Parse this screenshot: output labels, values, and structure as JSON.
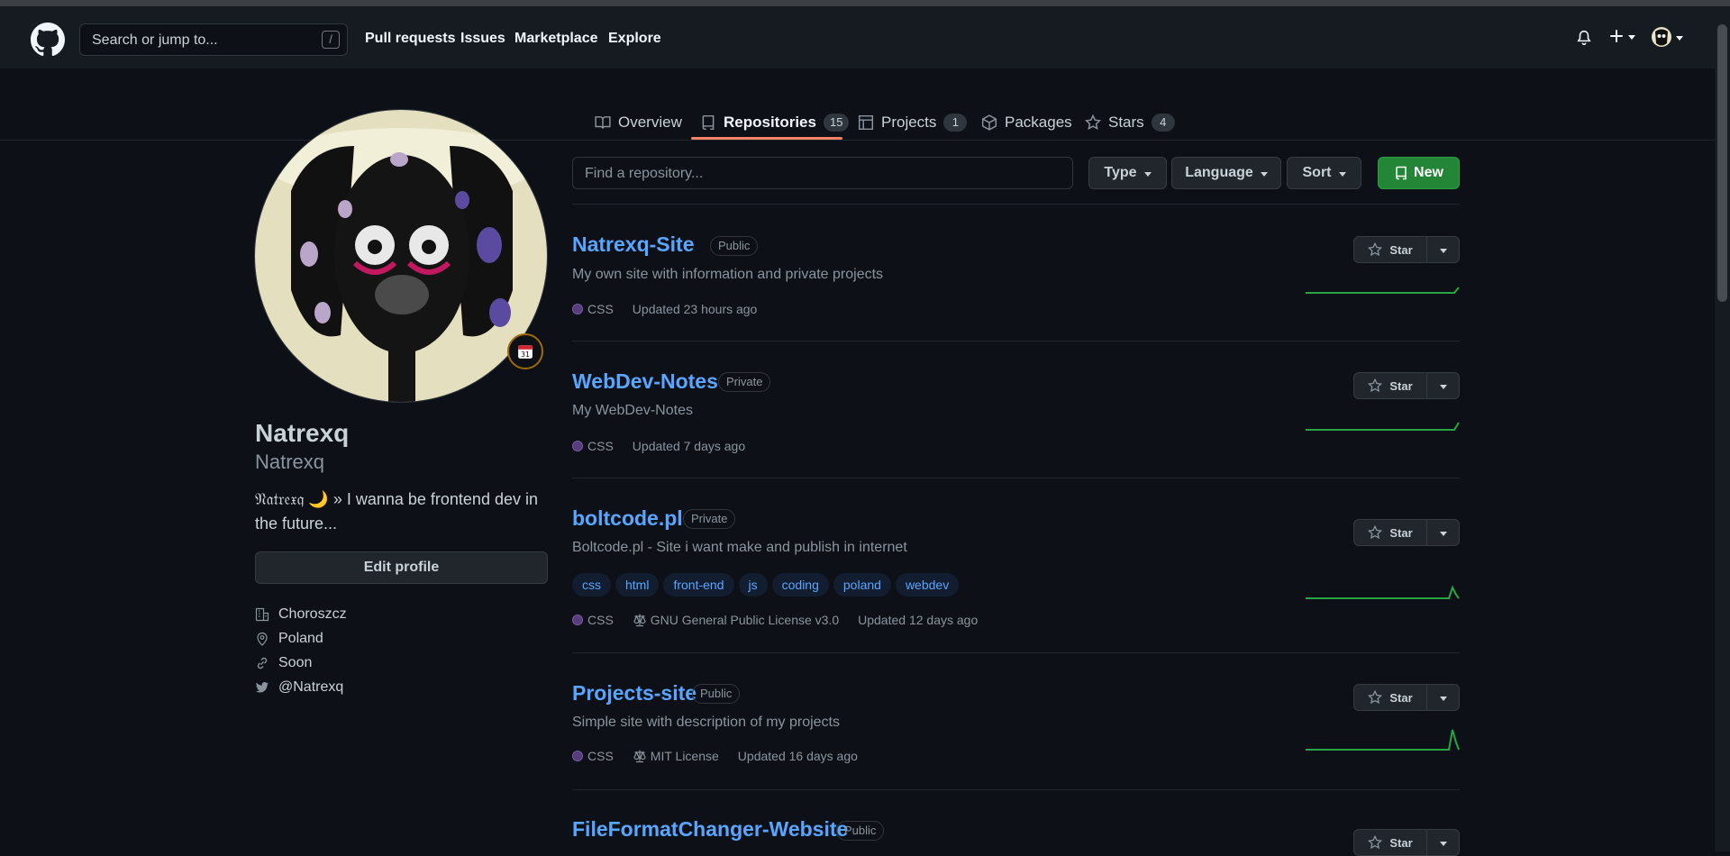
{
  "header": {
    "search_placeholder": "Search or jump to...",
    "search_shortcut": "/",
    "nav": [
      "Pull requests",
      "Issues",
      "Marketplace",
      "Explore"
    ]
  },
  "tabs": [
    {
      "label": "Overview",
      "icon": "book-icon"
    },
    {
      "label": "Repositories",
      "icon": "repo-icon",
      "count": "15",
      "selected": true
    },
    {
      "label": "Projects",
      "icon": "project-table-icon",
      "count": "1"
    },
    {
      "label": "Packages",
      "icon": "package-icon"
    },
    {
      "label": "Stars",
      "icon": "star-icon",
      "count": "4"
    }
  ],
  "profile": {
    "fullname": "Natrexq",
    "username": "Natrexq",
    "bio": "𝔑𝔞𝔱𝔯𝔢𝔵𝔮 🌙 » I wanna be frontend dev in the future...",
    "edit_label": "Edit profile",
    "details": [
      {
        "icon": "organization-icon",
        "text": "Choroszcz"
      },
      {
        "icon": "location-icon",
        "text": "Poland"
      },
      {
        "icon": "link-icon",
        "text": "Soon"
      },
      {
        "icon": "twitter-icon",
        "text": "@Natrexq"
      }
    ]
  },
  "filters": {
    "search_placeholder": "Find a repository...",
    "type_label": "Type",
    "language_label": "Language",
    "sort_label": "Sort",
    "new_label": "New"
  },
  "repos": [
    {
      "name": "Natrexq-Site",
      "visibility": "Public",
      "description": "My own site with information and private projects",
      "language": "CSS",
      "updated": "Updated 23 hours ago",
      "star_label": "Star"
    },
    {
      "name": "WebDev-Notes",
      "visibility": "Private",
      "description": "My WebDev-Notes",
      "language": "CSS",
      "updated": "Updated 7 days ago",
      "star_label": "Star"
    },
    {
      "name": "boltcode.pl",
      "visibility": "Private",
      "description": "Boltcode.pl - Site i want make and publish in internet",
      "topics": [
        "css",
        "html",
        "front-end",
        "js",
        "coding",
        "poland",
        "webdev"
      ],
      "language": "CSS",
      "license": "GNU General Public License v3.0",
      "updated": "Updated 12 days ago",
      "star_label": "Star"
    },
    {
      "name": "Projects-site",
      "visibility": "Public",
      "description": "Simple site with description of my projects",
      "language": "CSS",
      "license": "MIT License",
      "updated": "Updated 16 days ago",
      "star_label": "Star"
    },
    {
      "name": "FileFormatChanger-Website",
      "visibility": "Public",
      "star_label": "Star"
    }
  ],
  "colors": {
    "accent_green": "#238636",
    "link_blue": "#58a6ff",
    "tab_underline": "#f78166",
    "css_lang": "#563d7c"
  }
}
